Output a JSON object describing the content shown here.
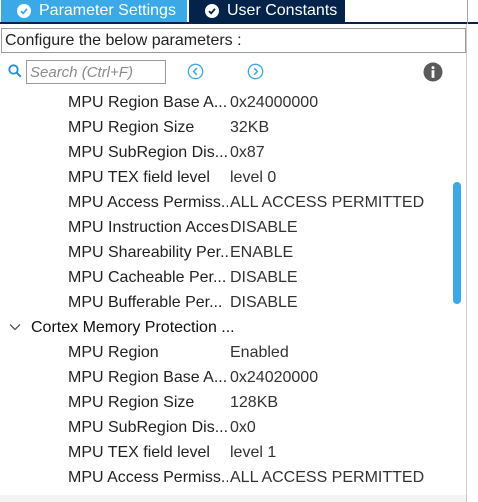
{
  "tabs": [
    {
      "label": "Parameter Settings",
      "active": true
    },
    {
      "label": "User Constants",
      "active": false
    }
  ],
  "description": "Configure the below parameters :",
  "search": {
    "placeholder": "Search (Ctrl+F)"
  },
  "icons": {
    "search": "search-icon",
    "prev": "circle-chevron-left-icon",
    "next": "circle-chevron-right-icon",
    "info": "info-icon",
    "tab_check": "check-circle-icon",
    "collapse": "chevron-down-icon"
  },
  "colors": {
    "active_tab": "#3aa9e6",
    "inactive_tab": "#03234b",
    "scroll_thumb": "#3aa9e6"
  },
  "rows": [
    {
      "kind": "param",
      "name": "MPU Region Base A...",
      "value": "0x24000000"
    },
    {
      "kind": "param",
      "name": "MPU Region Size",
      "value": "32KB"
    },
    {
      "kind": "param",
      "name": "MPU SubRegion Dis...",
      "value": "0x87"
    },
    {
      "kind": "param",
      "name": "MPU TEX field level",
      "value": "level 0"
    },
    {
      "kind": "param",
      "name": "MPU Access Permiss...",
      "value": "ALL ACCESS PERMITTED"
    },
    {
      "kind": "param",
      "name": "MPU Instruction Acces...",
      "value": "DISABLE"
    },
    {
      "kind": "param",
      "name": "MPU Shareability Per...",
      "value": "ENABLE"
    },
    {
      "kind": "param",
      "name": "MPU Cacheable Per...",
      "value": "DISABLE"
    },
    {
      "kind": "param",
      "name": "MPU Bufferable  Per...",
      "value": "DISABLE"
    },
    {
      "kind": "group",
      "name": "Cortex Memory Protection ...",
      "expanded": true
    },
    {
      "kind": "param",
      "name": "MPU Region",
      "value": "Enabled"
    },
    {
      "kind": "param",
      "name": "MPU Region Base A...",
      "value": "0x24020000"
    },
    {
      "kind": "param",
      "name": "MPU Region Size",
      "value": "128KB"
    },
    {
      "kind": "param",
      "name": "MPU SubRegion Dis...",
      "value": "0x0"
    },
    {
      "kind": "param",
      "name": "MPU TEX field level",
      "value": "level 1"
    },
    {
      "kind": "param",
      "name": "MPU Access Permiss...",
      "value": "ALL ACCESS PERMITTED"
    }
  ]
}
